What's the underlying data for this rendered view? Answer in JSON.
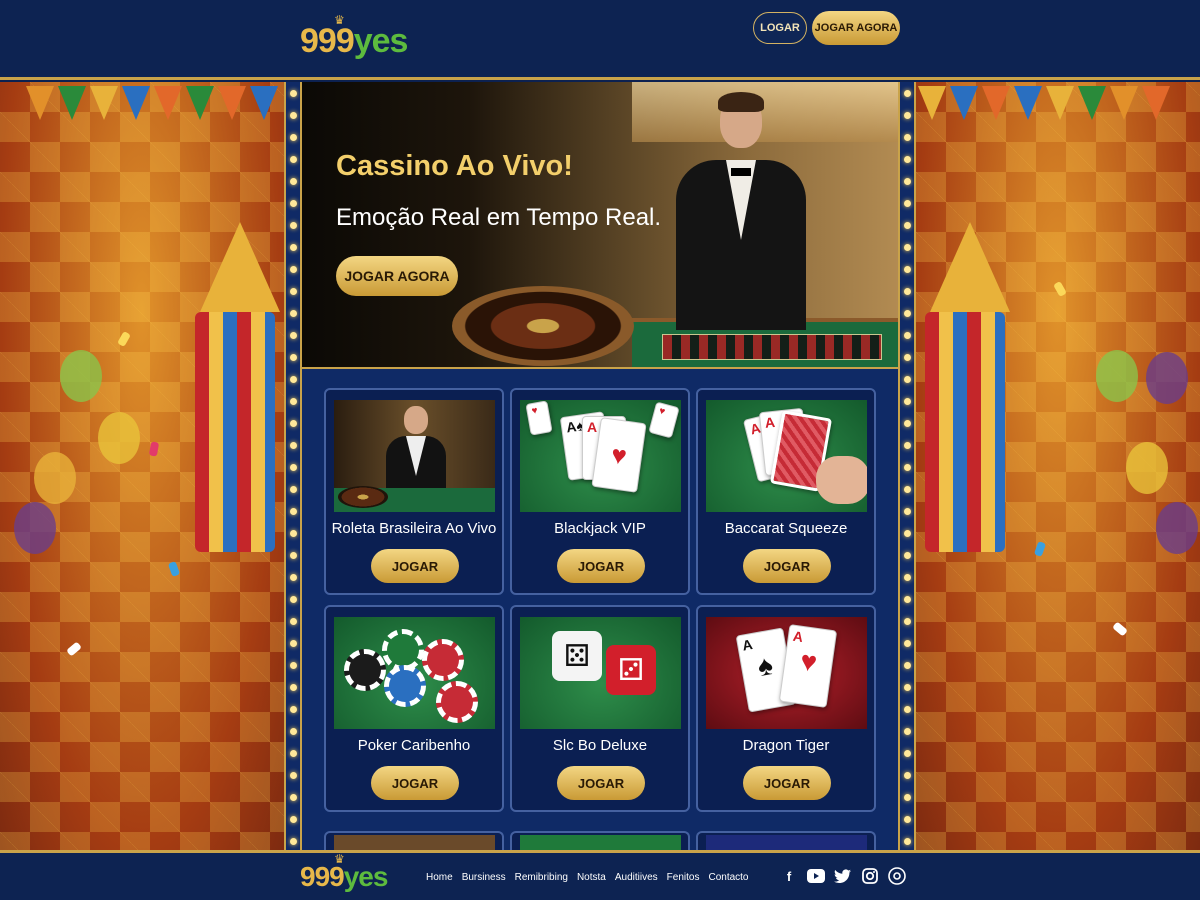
{
  "brand": {
    "number": "999",
    "word": "yes"
  },
  "header": {
    "login_label": "LOGAR",
    "play_label": "JOGAR AGORA"
  },
  "hero": {
    "title": "Cassino Ao Vivo!",
    "subtitle": "Emoção Real em Tempo Real.",
    "button_label": "JOGAR AGORA"
  },
  "games": [
    {
      "title": "Roleta Brasileira Ao Vivo",
      "button": "JOGAR"
    },
    {
      "title": "Blackjack VIP",
      "button": "JOGAR"
    },
    {
      "title": "Baccarat Squeeze",
      "button": "JOGAR"
    },
    {
      "title": "Poker Caribenho",
      "button": "JOGAR"
    },
    {
      "title": "Slc Bo Deluxe",
      "button": "JOGAR"
    },
    {
      "title": "Dragon Tiger",
      "button": "JOGAR"
    }
  ],
  "footer": {
    "nav": [
      "Home",
      "Bursiness",
      "Remibribing",
      "Notsta",
      "Auditiives",
      "Fenitos",
      "Contacto"
    ],
    "social_icons": [
      "facebook-icon",
      "youtube-icon",
      "twitter-icon",
      "instagram-icon",
      "responsible-gaming-icon"
    ]
  },
  "colors": {
    "navy": "#0d2352",
    "gold": "#c9a34a",
    "button_gold": "#e7b84a",
    "logo_green": "#5dbb3e"
  }
}
